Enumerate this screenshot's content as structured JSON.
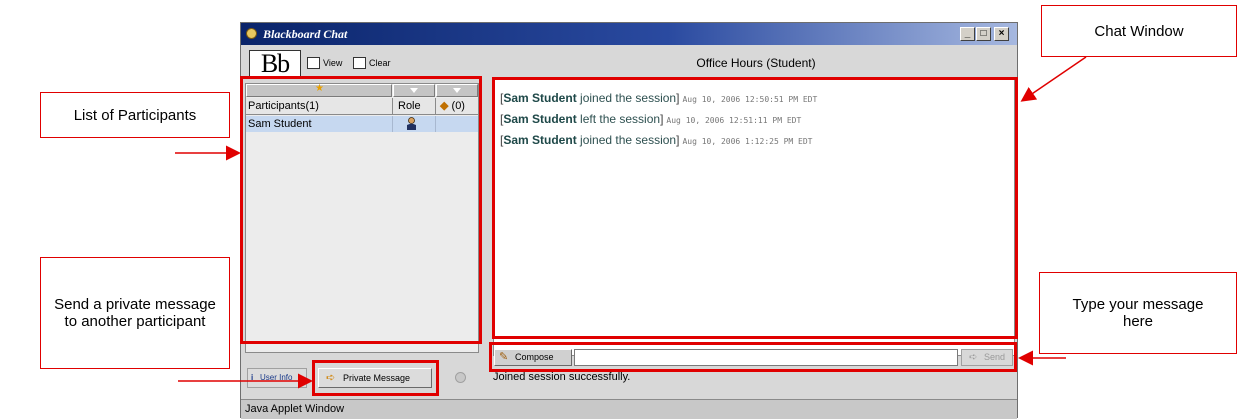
{
  "window": {
    "title": "Blackboard Chat",
    "controls": {
      "minimize": "_",
      "maximize": "□",
      "close": "×"
    }
  },
  "toolbar": {
    "logo": "Bb",
    "view_label": "View",
    "clear_label": "Clear"
  },
  "session_title": "Office Hours (Student)",
  "participants": {
    "header": {
      "name": "Participants(1)",
      "role": "Role",
      "count": "(0)"
    },
    "rows": [
      {
        "name": "Sam Student"
      }
    ]
  },
  "messages": [
    {
      "open": "[",
      "who": "Sam Student",
      "action": " joined the session",
      "close": "]",
      "time": "Aug 10, 2006 12:50:51 PM EDT"
    },
    {
      "open": "[",
      "who": "Sam Student",
      "action": " left the session",
      "close": "]",
      "time": "Aug 10, 2006 12:51:11 PM EDT"
    },
    {
      "open": "[",
      "who": "Sam Student",
      "action": " joined the session",
      "close": "]",
      "time": "Aug 10, 2006 1:12:25 PM EDT"
    }
  ],
  "bottom": {
    "compose_label": "Compose",
    "send_label": "Send",
    "input_value": "",
    "status": "Joined session successfully.",
    "user_info_label": "User Info",
    "private_message_label": "Private Message",
    "applet_label": "Java Applet Window"
  },
  "callouts": {
    "participants": "List of Participants",
    "chat_window": "Chat Window",
    "private_message": "Send a private message to another participant",
    "type_message": "Type your message here"
  },
  "colors": {
    "highlight": "#e00000",
    "titlebar": "#0a246a"
  }
}
